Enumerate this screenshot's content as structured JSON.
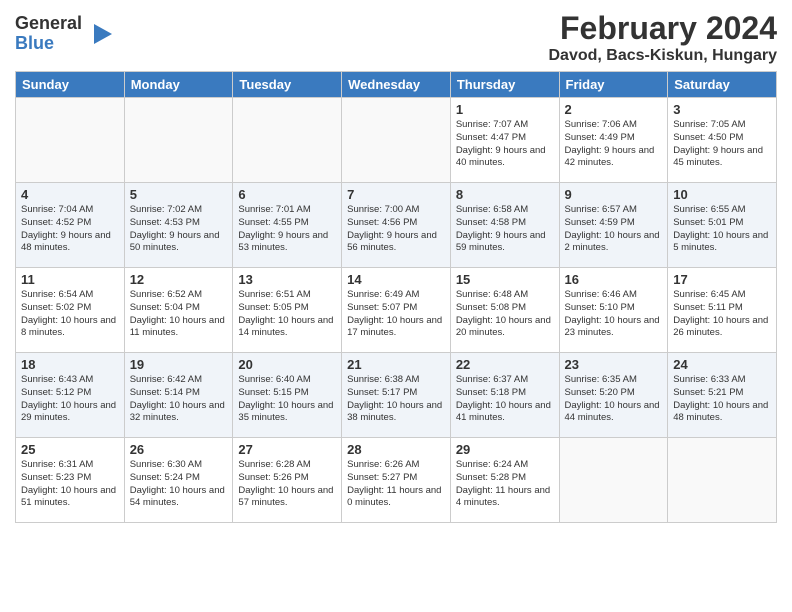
{
  "logo": {
    "general": "General",
    "blue": "Blue"
  },
  "title": "February 2024",
  "location": "Davod, Bacs-Kiskun, Hungary",
  "days_of_week": [
    "Sunday",
    "Monday",
    "Tuesday",
    "Wednesday",
    "Thursday",
    "Friday",
    "Saturday"
  ],
  "weeks": [
    [
      {
        "day": "",
        "info": ""
      },
      {
        "day": "",
        "info": ""
      },
      {
        "day": "",
        "info": ""
      },
      {
        "day": "",
        "info": ""
      },
      {
        "day": "1",
        "sunrise": "Sunrise: 7:07 AM",
        "sunset": "Sunset: 4:47 PM",
        "daylight": "Daylight: 9 hours and 40 minutes."
      },
      {
        "day": "2",
        "sunrise": "Sunrise: 7:06 AM",
        "sunset": "Sunset: 4:49 PM",
        "daylight": "Daylight: 9 hours and 42 minutes."
      },
      {
        "day": "3",
        "sunrise": "Sunrise: 7:05 AM",
        "sunset": "Sunset: 4:50 PM",
        "daylight": "Daylight: 9 hours and 45 minutes."
      }
    ],
    [
      {
        "day": "4",
        "sunrise": "Sunrise: 7:04 AM",
        "sunset": "Sunset: 4:52 PM",
        "daylight": "Daylight: 9 hours and 48 minutes."
      },
      {
        "day": "5",
        "sunrise": "Sunrise: 7:02 AM",
        "sunset": "Sunset: 4:53 PM",
        "daylight": "Daylight: 9 hours and 50 minutes."
      },
      {
        "day": "6",
        "sunrise": "Sunrise: 7:01 AM",
        "sunset": "Sunset: 4:55 PM",
        "daylight": "Daylight: 9 hours and 53 minutes."
      },
      {
        "day": "7",
        "sunrise": "Sunrise: 7:00 AM",
        "sunset": "Sunset: 4:56 PM",
        "daylight": "Daylight: 9 hours and 56 minutes."
      },
      {
        "day": "8",
        "sunrise": "Sunrise: 6:58 AM",
        "sunset": "Sunset: 4:58 PM",
        "daylight": "Daylight: 9 hours and 59 minutes."
      },
      {
        "day": "9",
        "sunrise": "Sunrise: 6:57 AM",
        "sunset": "Sunset: 4:59 PM",
        "daylight": "Daylight: 10 hours and 2 minutes."
      },
      {
        "day": "10",
        "sunrise": "Sunrise: 6:55 AM",
        "sunset": "Sunset: 5:01 PM",
        "daylight": "Daylight: 10 hours and 5 minutes."
      }
    ],
    [
      {
        "day": "11",
        "sunrise": "Sunrise: 6:54 AM",
        "sunset": "Sunset: 5:02 PM",
        "daylight": "Daylight: 10 hours and 8 minutes."
      },
      {
        "day": "12",
        "sunrise": "Sunrise: 6:52 AM",
        "sunset": "Sunset: 5:04 PM",
        "daylight": "Daylight: 10 hours and 11 minutes."
      },
      {
        "day": "13",
        "sunrise": "Sunrise: 6:51 AM",
        "sunset": "Sunset: 5:05 PM",
        "daylight": "Daylight: 10 hours and 14 minutes."
      },
      {
        "day": "14",
        "sunrise": "Sunrise: 6:49 AM",
        "sunset": "Sunset: 5:07 PM",
        "daylight": "Daylight: 10 hours and 17 minutes."
      },
      {
        "day": "15",
        "sunrise": "Sunrise: 6:48 AM",
        "sunset": "Sunset: 5:08 PM",
        "daylight": "Daylight: 10 hours and 20 minutes."
      },
      {
        "day": "16",
        "sunrise": "Sunrise: 6:46 AM",
        "sunset": "Sunset: 5:10 PM",
        "daylight": "Daylight: 10 hours and 23 minutes."
      },
      {
        "day": "17",
        "sunrise": "Sunrise: 6:45 AM",
        "sunset": "Sunset: 5:11 PM",
        "daylight": "Daylight: 10 hours and 26 minutes."
      }
    ],
    [
      {
        "day": "18",
        "sunrise": "Sunrise: 6:43 AM",
        "sunset": "Sunset: 5:12 PM",
        "daylight": "Daylight: 10 hours and 29 minutes."
      },
      {
        "day": "19",
        "sunrise": "Sunrise: 6:42 AM",
        "sunset": "Sunset: 5:14 PM",
        "daylight": "Daylight: 10 hours and 32 minutes."
      },
      {
        "day": "20",
        "sunrise": "Sunrise: 6:40 AM",
        "sunset": "Sunset: 5:15 PM",
        "daylight": "Daylight: 10 hours and 35 minutes."
      },
      {
        "day": "21",
        "sunrise": "Sunrise: 6:38 AM",
        "sunset": "Sunset: 5:17 PM",
        "daylight": "Daylight: 10 hours and 38 minutes."
      },
      {
        "day": "22",
        "sunrise": "Sunrise: 6:37 AM",
        "sunset": "Sunset: 5:18 PM",
        "daylight": "Daylight: 10 hours and 41 minutes."
      },
      {
        "day": "23",
        "sunrise": "Sunrise: 6:35 AM",
        "sunset": "Sunset: 5:20 PM",
        "daylight": "Daylight: 10 hours and 44 minutes."
      },
      {
        "day": "24",
        "sunrise": "Sunrise: 6:33 AM",
        "sunset": "Sunset: 5:21 PM",
        "daylight": "Daylight: 10 hours and 48 minutes."
      }
    ],
    [
      {
        "day": "25",
        "sunrise": "Sunrise: 6:31 AM",
        "sunset": "Sunset: 5:23 PM",
        "daylight": "Daylight: 10 hours and 51 minutes."
      },
      {
        "day": "26",
        "sunrise": "Sunrise: 6:30 AM",
        "sunset": "Sunset: 5:24 PM",
        "daylight": "Daylight: 10 hours and 54 minutes."
      },
      {
        "day": "27",
        "sunrise": "Sunrise: 6:28 AM",
        "sunset": "Sunset: 5:26 PM",
        "daylight": "Daylight: 10 hours and 57 minutes."
      },
      {
        "day": "28",
        "sunrise": "Sunrise: 6:26 AM",
        "sunset": "Sunset: 5:27 PM",
        "daylight": "Daylight: 11 hours and 0 minutes."
      },
      {
        "day": "29",
        "sunrise": "Sunrise: 6:24 AM",
        "sunset": "Sunset: 5:28 PM",
        "daylight": "Daylight: 11 hours and 4 minutes."
      },
      {
        "day": "",
        "info": ""
      },
      {
        "day": "",
        "info": ""
      }
    ]
  ]
}
